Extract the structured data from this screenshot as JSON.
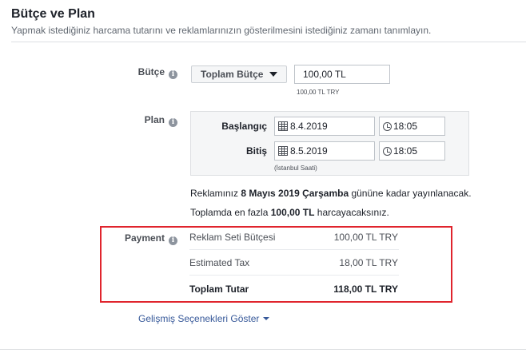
{
  "section": {
    "title": "Bütçe ve Plan",
    "subtitle": "Yapmak istediğiniz harcama tutarını ve reklamlarınızın gösterilmesini istediğiniz zamanı tanımlayın."
  },
  "budget": {
    "label": "Bütçe",
    "type_select": "Toplam Bütçe",
    "amount": "100,00 TL",
    "hint": "100,00 TL TRY"
  },
  "schedule": {
    "label": "Plan",
    "start_label": "Başlangıç",
    "start_date": "8.4.2019",
    "start_time": "18:05",
    "end_label": "Bitiş",
    "end_date": "8.5.2019",
    "end_time": "18:05",
    "timezone": "(İstanbul Saati)"
  },
  "summary": {
    "line1_pre": "Reklamınız ",
    "line1_date": "8 Mayıs 2019 Çarşamba",
    "line1_post": " gününe kadar yayınlanacak.",
    "line2_pre": "Toplamda en fazla ",
    "line2_amount": "100,00 TL",
    "line2_post": " harcayacaksınız."
  },
  "payment": {
    "label": "Payment",
    "rows": [
      {
        "label": "Reklam Seti Bütçesi",
        "value": "100,00 TL TRY"
      },
      {
        "label": "Estimated Tax",
        "value": "18,00 TL TRY"
      },
      {
        "label": "Toplam Tutar",
        "value": "118,00 TL TRY"
      }
    ],
    "highlight_color": "#e0242d"
  },
  "advanced": {
    "link": "Gelişmiş Seçenekleri Göster"
  },
  "icons": {
    "info": "info-icon",
    "calendar": "calendar-icon",
    "clock": "clock-icon",
    "dropdown": "chevron-down-icon"
  }
}
